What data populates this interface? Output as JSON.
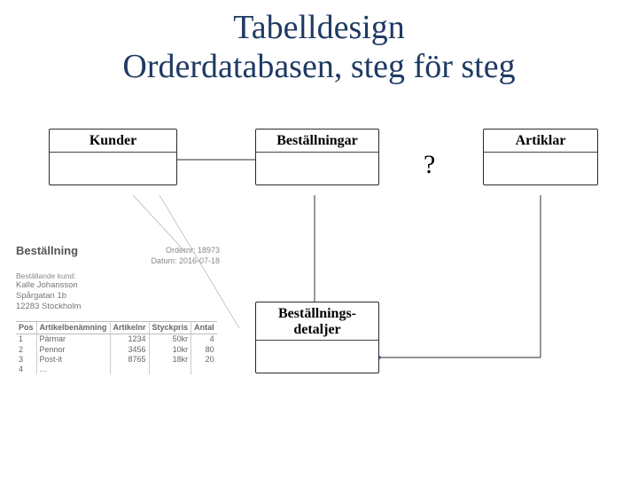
{
  "title": {
    "line1": "Tabelldesign",
    "line2": "Orderdatabasen, steg för steg"
  },
  "entities": {
    "kunder": "Kunder",
    "bestallningar": "Beställningar",
    "artiklar": "Artiklar",
    "detaljer": "Beställnings-\ndetaljer"
  },
  "question_mark": "?",
  "sample": {
    "heading": "Beställning",
    "meta_order_label": "Ordernr: ",
    "meta_order_value": "18973",
    "meta_date_label": "Datum: ",
    "meta_date_value": "2016-07-18",
    "cust_label": "Beställande kund:",
    "cust_name": "Kalle Johansson",
    "cust_street": "Spårgatan 1b",
    "cust_city": "12283 Stockholm",
    "cols": {
      "pos": "Pos",
      "benamning": "Artikelbenämning",
      "artikelnr": "Artikelnr",
      "styckpris": "Styckpris",
      "antal": "Antal"
    },
    "rows": [
      {
        "pos": "1",
        "ben": "Pärmar",
        "art": "1234",
        "pris": "50kr",
        "antal": "4"
      },
      {
        "pos": "2",
        "ben": "Pennor",
        "art": "3456",
        "pris": "10kr",
        "antal": "80"
      },
      {
        "pos": "3",
        "ben": "Post-it",
        "art": "8765",
        "pris": "18kr",
        "antal": "20"
      },
      {
        "pos": "4",
        "ben": "…",
        "art": "",
        "pris": "",
        "antal": ""
      }
    ]
  }
}
